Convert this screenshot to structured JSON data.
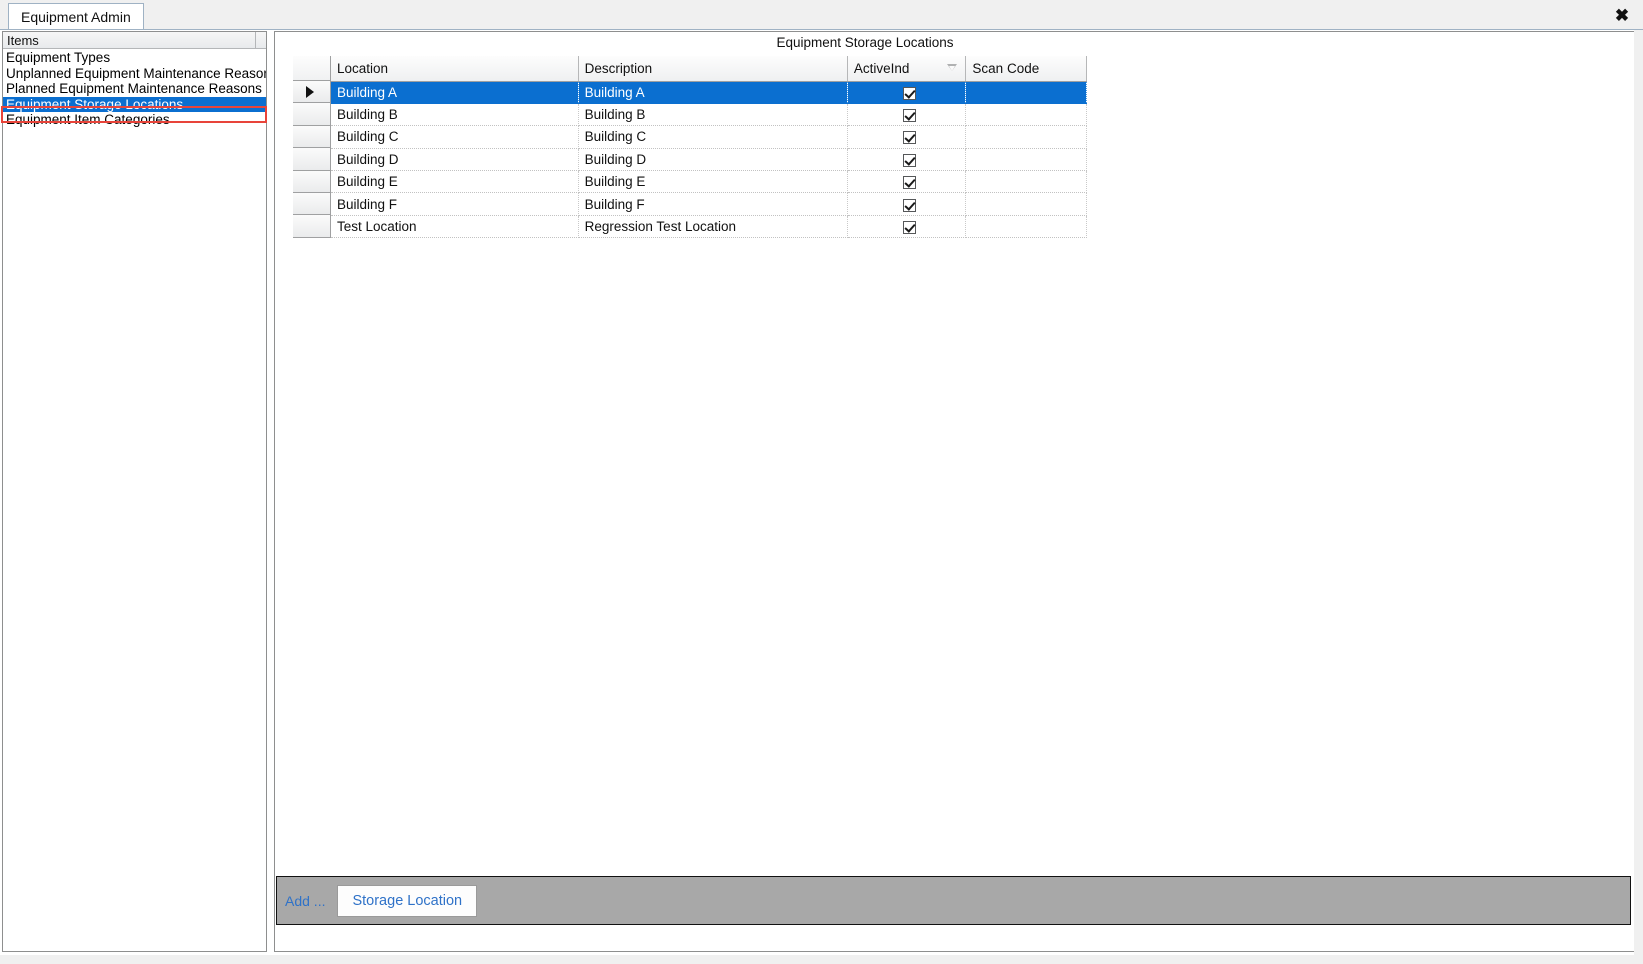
{
  "window": {
    "tab_label": "Equipment Admin",
    "close_icon": "close-icon",
    "close_glyph": "✖"
  },
  "sidebar": {
    "header_label": "Items",
    "items": [
      {
        "label": "Equipment Types",
        "selected": false
      },
      {
        "label": "Unplanned Equipment Maintenance Reasons",
        "selected": false
      },
      {
        "label": "Planned Equipment Maintenance Reasons",
        "selected": false
      },
      {
        "label": "Equipment Storage Locations",
        "selected": true
      },
      {
        "label": "Equipment Item Categories",
        "selected": false
      }
    ],
    "selection_highlight_color": "#e8443a",
    "selection_background_color": "#0b6fd0"
  },
  "main": {
    "title": "Equipment Storage Locations",
    "grid": {
      "columns": [
        {
          "label": "Location",
          "sorted": false,
          "sort_direction": ""
        },
        {
          "label": "Description",
          "sorted": false,
          "sort_direction": ""
        },
        {
          "label": "ActiveInd",
          "sorted": true,
          "sort_direction": "descending"
        },
        {
          "label": "Scan Code",
          "sorted": false,
          "sort_direction": ""
        }
      ],
      "rows": [
        {
          "location": "Building A",
          "description": "Building A",
          "active_ind": true,
          "scan_code": "",
          "selected": true,
          "current": true
        },
        {
          "location": "Building B",
          "description": "Building B",
          "active_ind": true,
          "scan_code": "",
          "selected": false,
          "current": false
        },
        {
          "location": "Building C",
          "description": "Building C",
          "active_ind": true,
          "scan_code": "",
          "selected": false,
          "current": false
        },
        {
          "location": "Building D",
          "description": "Building D",
          "active_ind": true,
          "scan_code": "",
          "selected": false,
          "current": false
        },
        {
          "location": "Building E",
          "description": "Building E",
          "active_ind": true,
          "scan_code": "",
          "selected": false,
          "current": false
        },
        {
          "location": "Building F",
          "description": "Building F",
          "active_ind": true,
          "scan_code": "",
          "selected": false,
          "current": false
        },
        {
          "location": "Test Location",
          "description": "Regression Test Location",
          "active_ind": true,
          "scan_code": "",
          "selected": false,
          "current": false
        }
      ]
    }
  },
  "bottom_bar": {
    "add_label": "Add ...",
    "storage_location_button_label": "Storage Location",
    "background_color": "#a8a8a8",
    "link_color": "#2f72c8"
  }
}
